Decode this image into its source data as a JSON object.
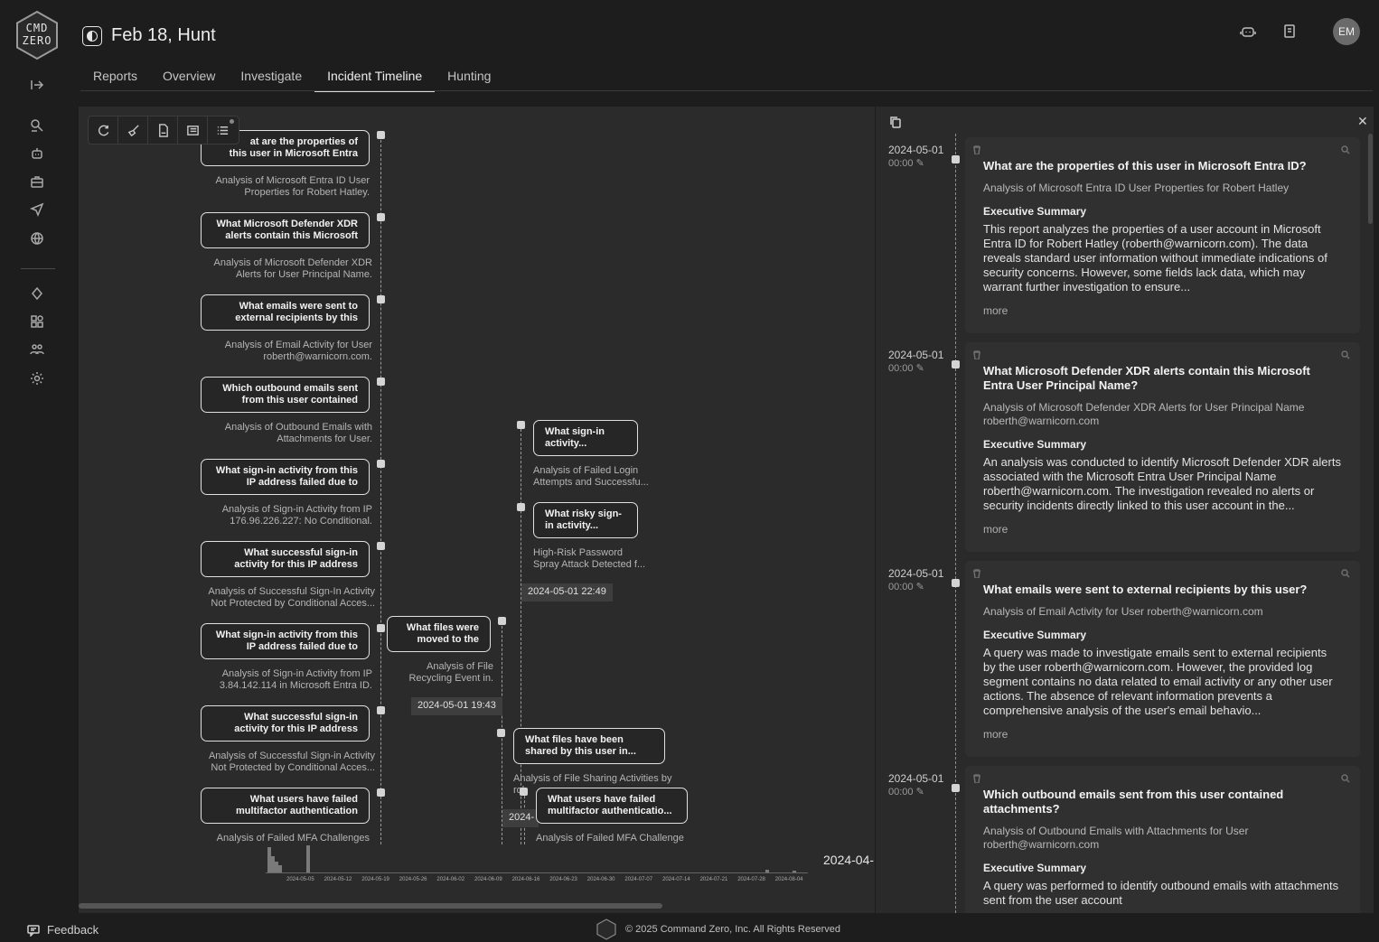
{
  "app": {
    "logo_text_top": "CMD",
    "logo_text_bottom": "ZERO"
  },
  "header": {
    "title": "Feb 18, Hunt",
    "avatar_initials": "EM",
    "tabs": [
      {
        "label": "Reports"
      },
      {
        "label": "Overview"
      },
      {
        "label": "Investigate"
      },
      {
        "label": "Incident Timeline",
        "active": true
      },
      {
        "label": "Hunting"
      }
    ]
  },
  "timeline": {
    "cards_col1": [
      {
        "title_lines": [
          "at are the properties of",
          "this user in Microsoft Entra"
        ],
        "sub_lines": [
          "Analysis of Microsoft Entra ID User",
          "Properties for Robert Hatley."
        ]
      },
      {
        "title_lines": [
          "What Microsoft Defender XDR",
          "alerts contain this Microsoft"
        ],
        "sub_lines": [
          "Analysis of Microsoft Defender XDR",
          "Alerts for User Principal Name."
        ]
      },
      {
        "title_lines": [
          "What emails were sent to",
          "external recipients by this"
        ],
        "sub_lines": [
          "Analysis of Email Activity for User",
          "roberth@warnicorn.com."
        ]
      },
      {
        "title_lines": [
          "Which outbound emails sent",
          "from this user contained"
        ],
        "sub_lines": [
          "Analysis of Outbound Emails with",
          "Attachments for User."
        ]
      },
      {
        "title_lines": [
          "What sign-in activity from this",
          "IP address failed due to"
        ],
        "sub_lines": [
          "Analysis of Sign-in Activity from IP",
          "176.96.226.227: No Conditional."
        ]
      },
      {
        "title_lines": [
          "What successful sign-in",
          "activity for this IP address"
        ],
        "sub_lines": [
          "Analysis of Successful Sign-In Activity",
          "Not Protected by Conditional Acces..."
        ]
      },
      {
        "title_lines": [
          "What sign-in activity from this",
          "IP address failed due to"
        ],
        "sub_lines": [
          "Analysis of Sign-in Activity from IP",
          "3.84.142.114 in Microsoft Entra ID."
        ]
      },
      {
        "title_lines": [
          "What successful sign-in",
          "activity for this IP address"
        ],
        "sub_lines": [
          "Analysis of Successful Sign-in Activity",
          "Not Protected by Conditional Acces..."
        ]
      },
      {
        "title_lines": [
          "What users have failed",
          "multifactor authentication"
        ],
        "sub_lines": [
          "Analysis of Failed MFA Challenges"
        ]
      }
    ],
    "card_files_moved": {
      "title_lines": [
        "What files were",
        "moved to the"
      ],
      "sub_lines": [
        "Analysis of File",
        "Recycling Event in."
      ],
      "date": "2024-05-01 19:43"
    },
    "card_signin": {
      "title_lines": [
        "What sign-in",
        "activity..."
      ],
      "sub_lines": [
        "Analysis of Failed Login",
        "Attempts and Successfu..."
      ]
    },
    "card_risky": {
      "title_lines": [
        "What risky sign-",
        "in activity..."
      ],
      "sub_lines": [
        "High-Risk Password",
        "Spray Attack Detected f..."
      ],
      "date": "2024-05-01 22:49"
    },
    "card_shared": {
      "title_lines": [
        "What files have been",
        "shared by this user in..."
      ],
      "sub_lines": [
        "Analysis of File Sharing Activities by"
      ],
      "sub_clip": "rob",
      "date_clip": "2024-"
    },
    "card_mfa2": {
      "title_lines": [
        "What users have failed",
        "multifactor authenticatio..."
      ],
      "sub_lines": [
        "Analysis of Failed MFA Challenge"
      ]
    },
    "axis_date": "2024-04-",
    "histogram": {
      "ticks": [
        "2024-05-05",
        "2024-05-12",
        "2024-05-19",
        "2024-05-26",
        "2024-06-02",
        "2024-06-09",
        "2024-06-16",
        "2024-06-23",
        "2024-06-30",
        "2024-07-07",
        "2024-07-14",
        "2024-07-21",
        "2024-07-28",
        "2024-08-04"
      ]
    }
  },
  "detail": {
    "entries": [
      {
        "date": "2024-05-01",
        "time": "00:00",
        "question": "What are the properties of this user in Microsoft Entra ID?",
        "subtitle": "Analysis of Microsoft Entra ID User Properties for Robert Hatley",
        "exec_label": "Executive Summary",
        "body": "This report analyzes the properties of a user account in Microsoft Entra ID for Robert Hatley (roberth@warnicorn.com). The data reveals standard user information without immediate indications of security concerns. However, some fields lack data, which may warrant further investigation to ensure...",
        "more": "more"
      },
      {
        "date": "2024-05-01",
        "time": "00:00",
        "question": "What Microsoft Defender XDR alerts contain this Microsoft Entra User Principal Name?",
        "subtitle": "Analysis of Microsoft Defender XDR Alerts for User Principal Name roberth@warnicorn.com",
        "exec_label": "Executive Summary",
        "body": "An analysis was conducted to identify Microsoft Defender XDR alerts associated with the Microsoft Entra User Principal Name roberth@warnicorn.com. The investigation revealed no alerts or security incidents directly linked to this user account in the...",
        "more": "more"
      },
      {
        "date": "2024-05-01",
        "time": "00:00",
        "question": "What emails were sent to external recipients by this user?",
        "subtitle": "Analysis of Email Activity for User roberth@warnicorn.com",
        "exec_label": "Executive Summary",
        "body": "A query was made to investigate emails sent to external recipients by the user roberth@warnicorn.com. However, the provided log segment contains no data related to email activity or any other user actions. The absence of relevant information prevents a comprehensive analysis of the user's email behavio...",
        "more": "more"
      },
      {
        "date": "2024-05-01",
        "time": "00:00",
        "question": "Which outbound emails sent from this user contained attachments?",
        "subtitle": "Analysis of Outbound Emails with Attachments for User roberth@warnicorn.com",
        "exec_label": "Executive Summary",
        "body": "A query was performed to identify outbound emails with attachments sent from the user account",
        "more": ""
      }
    ]
  },
  "footer": {
    "feedback": "Feedback",
    "copyright": "© 2025 Command Zero, Inc.   All Rights Reserved"
  }
}
